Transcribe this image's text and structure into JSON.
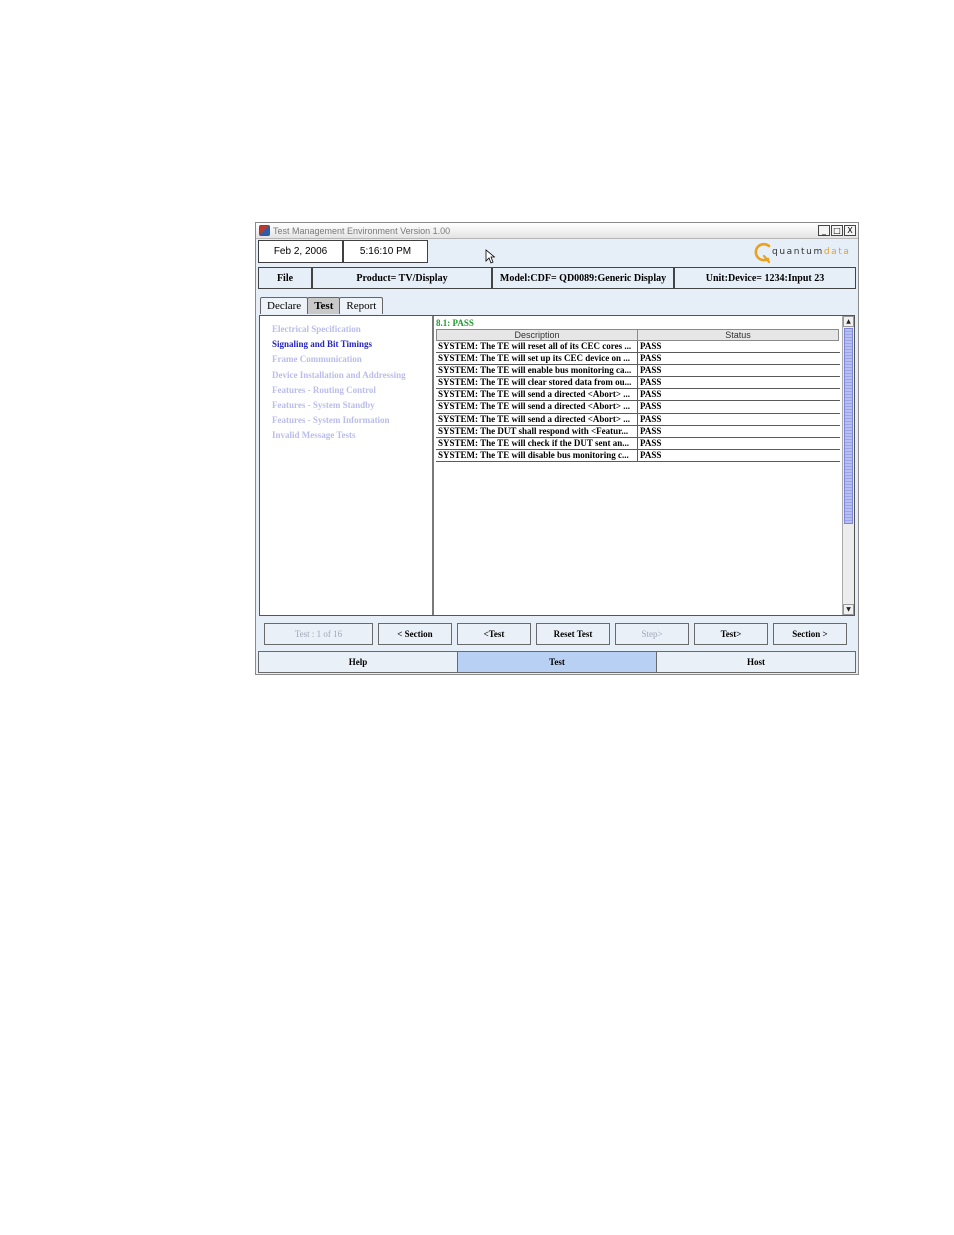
{
  "window": {
    "title": "Test Management Environment Version 1.00",
    "minimize": "_",
    "maximize": "□",
    "close": "X"
  },
  "header": {
    "date": "Feb 2, 2006",
    "time": "5:16:10 PM",
    "logo_primary": "quantum",
    "logo_secondary": "data"
  },
  "infobar": {
    "file_label": "File",
    "product": "Product= TV/Display",
    "model": "Model:CDF= QD0089:Generic Display",
    "unit": "Unit:Device= 1234:Input 23"
  },
  "tabs": [
    "Declare",
    "Test",
    "Report"
  ],
  "active_tab": "Test",
  "nav_items": [
    "Electrical Specification",
    "Signaling and Bit Timings",
    "Frame Communication",
    "Device Installation and Addressing",
    "Features - Routing Control",
    "Features - System Standby",
    "Features - System Information",
    "Invalid Message Tests"
  ],
  "current_nav": "Signaling and Bit Timings",
  "results": {
    "section_status": "8.1: PASS",
    "columns": [
      "Description",
      "Status"
    ],
    "rows": [
      {
        "description": "SYSTEM: The TE will reset all of its CEC cores ...",
        "status": "PASS"
      },
      {
        "description": "SYSTEM: The TE will set up its CEC device on ...",
        "status": "PASS"
      },
      {
        "description": "SYSTEM: The TE will enable bus monitoring ca...",
        "status": "PASS"
      },
      {
        "description": "SYSTEM: The TE will clear stored data from ou...",
        "status": "PASS"
      },
      {
        "description": "SYSTEM: The TE will send a directed <Abort> ...",
        "status": "PASS"
      },
      {
        "description": "SYSTEM: The TE will send a directed <Abort> ...",
        "status": "PASS"
      },
      {
        "description": "SYSTEM: The TE will send a directed <Abort> ...",
        "status": "PASS"
      },
      {
        "description": "SYSTEM: The DUT shall respond with <Featur...",
        "status": "PASS"
      },
      {
        "description": "SYSTEM: The TE will check if the DUT sent an...",
        "status": "PASS"
      },
      {
        "description": "SYSTEM: The TE will disable bus monitoring c...",
        "status": "PASS"
      }
    ]
  },
  "nav_buttons": {
    "counter": "Test : 1 of 16",
    "prev_section": "< Section",
    "prev_test": "<Test",
    "reset": "Reset Test",
    "step": "Step>",
    "next_test": "Test>",
    "next_section": "Section >"
  },
  "bottom_buttons": {
    "help": "Help",
    "test": "Test",
    "host": "Host"
  },
  "colors": {
    "pass_green": "#1f9b2e",
    "nav_current": "#2525b8",
    "nav_inactive": "#b9bde9",
    "logo_accent": "#e8a21c",
    "active_bottom": "#b8d0f4"
  }
}
